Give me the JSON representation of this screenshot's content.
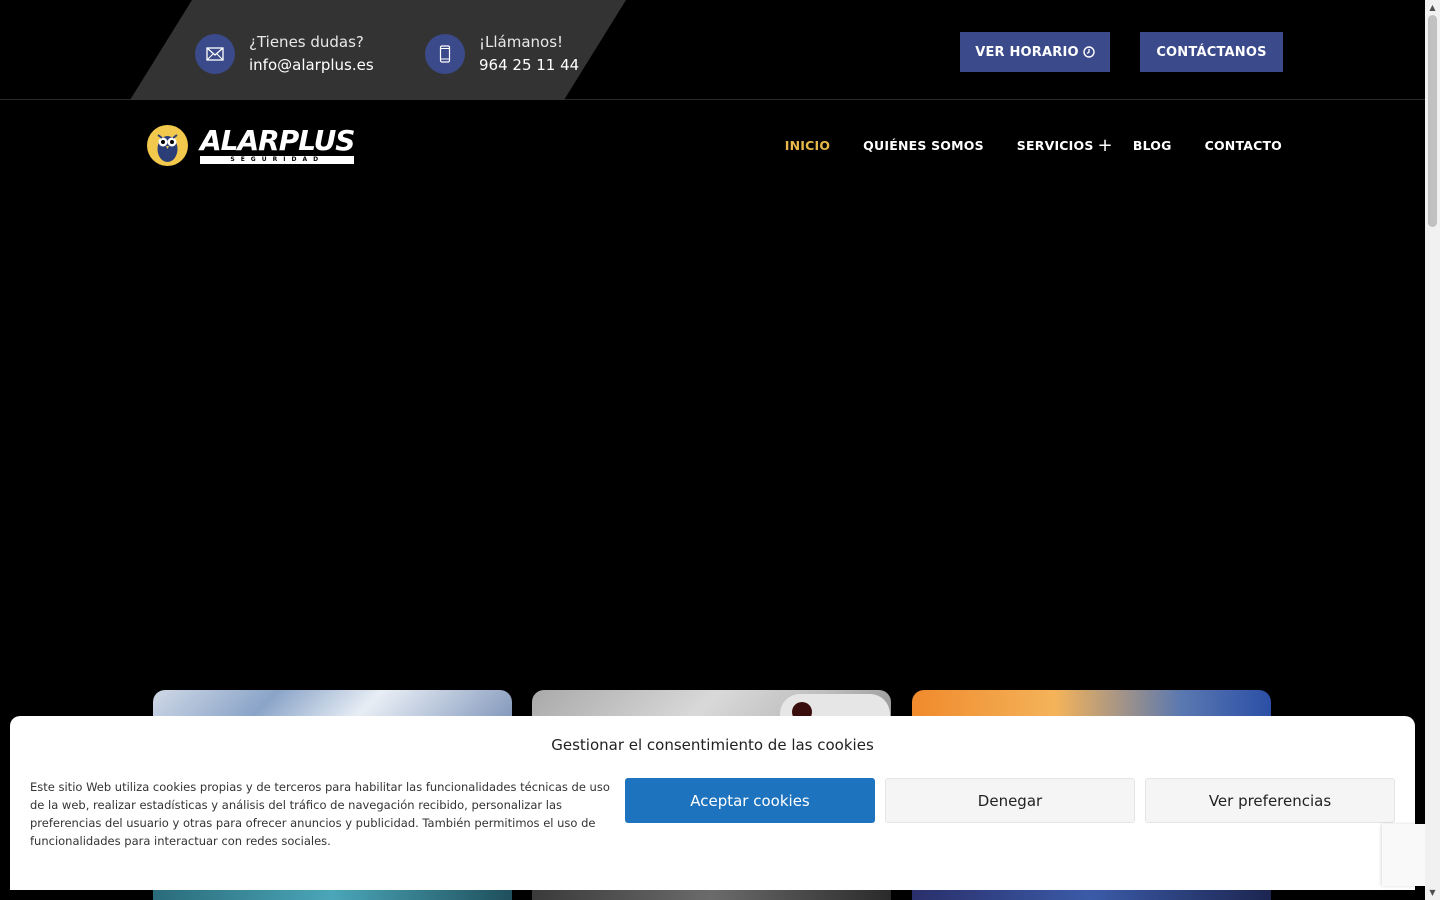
{
  "topbar": {
    "email_label": "¿Tienes dudas?",
    "email_value": "info@alarplus.es",
    "phone_label": "¡Llámanos!",
    "phone_value": "964 25 11 44",
    "schedule_button": "VER HORARIO",
    "contact_button": "CONTÁCTANOS",
    "accent_color": "#3b4a8a"
  },
  "brand": {
    "name": "ALARPLUS",
    "tagline": "SEGURIDAD"
  },
  "nav": {
    "items": [
      {
        "label": "INICIO",
        "active": true
      },
      {
        "label": "QUIÉNES SOMOS"
      },
      {
        "label": "SERVICIOS",
        "has_submenu": true
      },
      {
        "label": "BLOG"
      },
      {
        "label": "CONTACTO"
      }
    ],
    "active_color": "#e8b84a"
  },
  "cookie_banner": {
    "title": "Gestionar el consentimiento de las cookies",
    "text": "Este sitio Web utiliza cookies propias y de terceros para habilitar las funcionalidades técnicas de uso de la web, realizar estadísticas y análisis del tráfico de navegación recibido, personalizar las preferencias del usuario y otras para ofrecer anuncios y publicidad. También permitimos el uso de funcionalidades para interactuar con redes sociales.",
    "accept": "Aceptar cookies",
    "deny": "Denegar",
    "preferences": "Ver preferencias",
    "accept_color": "#1e73be"
  }
}
